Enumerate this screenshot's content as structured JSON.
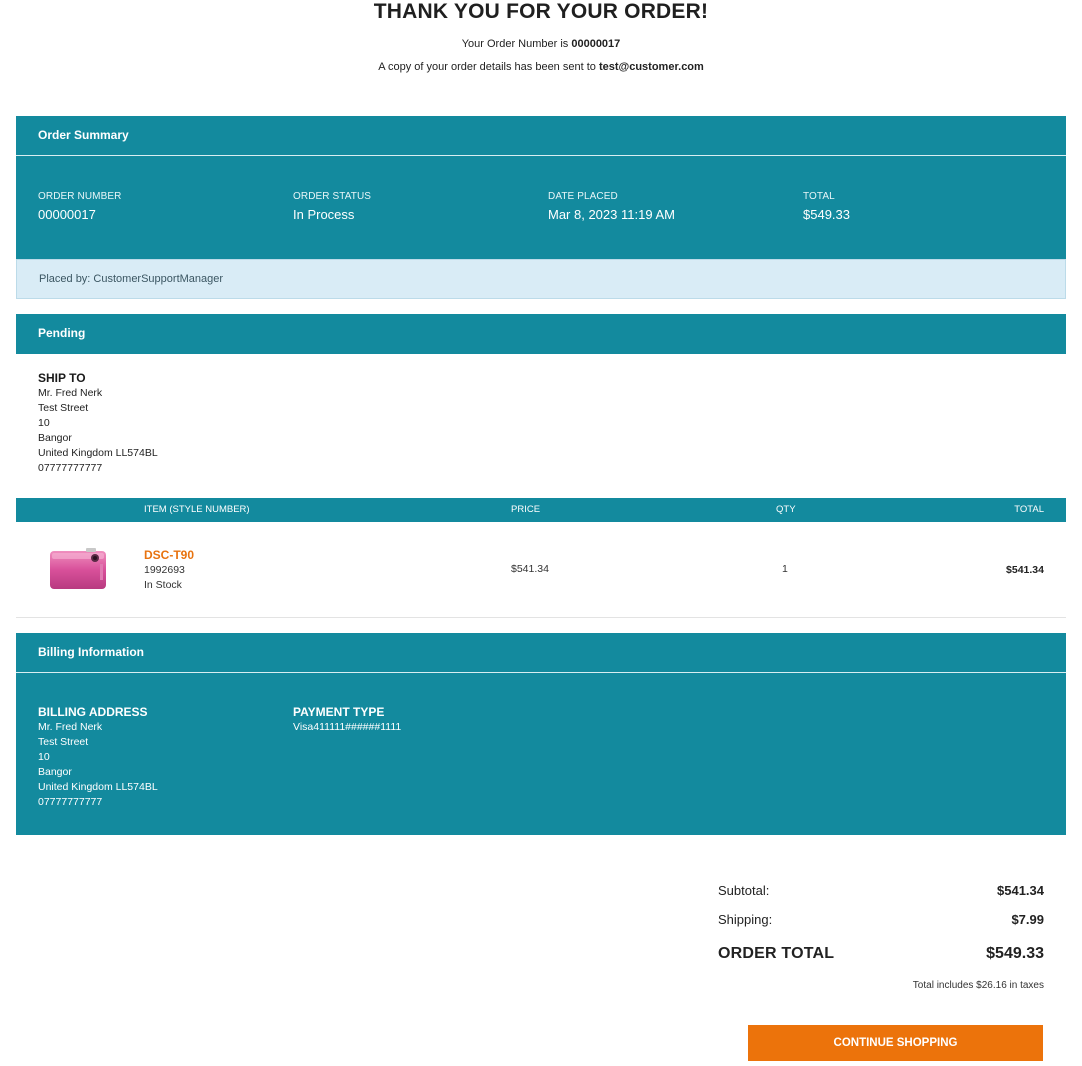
{
  "hero": {
    "title": "THANK YOU FOR YOUR ORDER!",
    "order_number_prefix": "Your Order Number is ",
    "order_number": "00000017",
    "email_prefix": "A copy of your order details has been sent to ",
    "email": "test@customer.com"
  },
  "order_summary": {
    "heading": "Order Summary",
    "fields": [
      {
        "label": "ORDER NUMBER",
        "value": "00000017"
      },
      {
        "label": "ORDER STATUS",
        "value": "In Process"
      },
      {
        "label": "DATE PLACED",
        "value": "Mar 8, 2023 11:19 AM"
      },
      {
        "label": "TOTAL",
        "value": "$549.33"
      }
    ],
    "placed_by": "Placed by: CustomerSupportManager"
  },
  "pending": {
    "heading": "Pending",
    "ship_to": {
      "title": "SHIP TO",
      "lines": [
        "Mr.  Fred Nerk",
        "Test Street",
        "10",
        "Bangor",
        "United Kingdom LL574BL",
        "07777777777"
      ]
    }
  },
  "items_table": {
    "headers": {
      "item": "ITEM (STYLE NUMBER)",
      "price": "PRICE",
      "qty": "QTY",
      "total": "TOTAL"
    },
    "rows": [
      {
        "name": "DSC-T90",
        "style_number": "1992693",
        "stock": "In Stock",
        "price": "$541.34",
        "qty": "1",
        "total": "$541.34",
        "image_icon": "pink-camera"
      }
    ]
  },
  "billing": {
    "heading": "Billing Information",
    "address": {
      "title": "BILLING ADDRESS",
      "lines": [
        "Mr.  Fred Nerk",
        "Test Street",
        "10",
        "Bangor",
        "United Kingdom LL574BL",
        "07777777777"
      ]
    },
    "payment": {
      "title": "PAYMENT TYPE",
      "value": "Visa411111######1111"
    }
  },
  "totals": {
    "subtotal_label": "Subtotal:",
    "subtotal": "$541.34",
    "shipping_label": "Shipping:",
    "shipping": "$7.99",
    "order_total_label": "ORDER TOTAL",
    "order_total": "$549.33",
    "tax_note": "Total includes $26.16 in taxes"
  },
  "actions": {
    "continue_label": "CONTINUE SHOPPING"
  },
  "colors": {
    "teal": "#138a9e",
    "light_blue": "#d9ecf6",
    "orange": "#ec730b"
  }
}
